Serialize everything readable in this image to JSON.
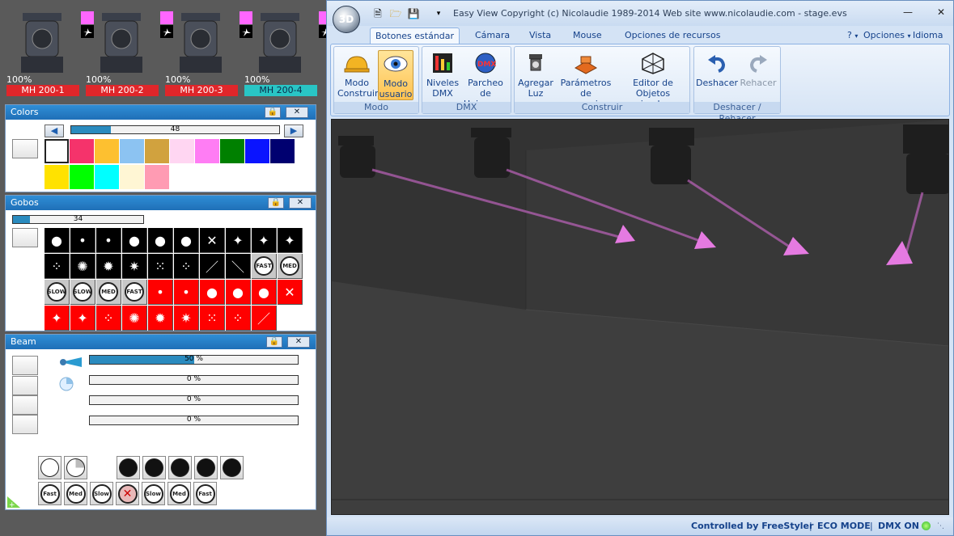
{
  "fixtures": [
    {
      "name": "MH 200-1",
      "percent": "100%",
      "selected": false
    },
    {
      "name": "MH 200-2",
      "percent": "100%",
      "selected": false
    },
    {
      "name": "MH 200-3",
      "percent": "100%",
      "selected": false
    },
    {
      "name": "MH 200-4",
      "percent": "100%",
      "selected": true
    }
  ],
  "colors_panel": {
    "title": "Colors",
    "value": "48",
    "value_fraction": 0.19,
    "swatches": [
      "#ffffff",
      "#f5336b",
      "#fdc030",
      "#8cc3f2",
      "#d1a23e",
      "#ffd6f2",
      "#ff7df4",
      "#008000",
      "#0a14ff",
      "#000070",
      "#ffe200",
      "#00ff00",
      "#00ffff",
      "#fff6d4",
      "#ff9bb3"
    ]
  },
  "gobos_panel": {
    "title": "Gobos",
    "value": "34",
    "value_fraction": 0.13
  },
  "beam_panel": {
    "title": "Beam",
    "bars": [
      {
        "label": "50 %",
        "fraction": 0.5
      },
      {
        "label": "0 %",
        "fraction": 0
      },
      {
        "label": "0 %",
        "fraction": 0
      },
      {
        "label": "0 %",
        "fraction": 0
      }
    ],
    "speed_row": [
      "Fast",
      "Med",
      "Slow",
      "",
      "Slow",
      "Med",
      "Fast"
    ]
  },
  "window": {
    "title": "Easy View   Copyright (c) Nicolaudie 1989-2014   Web site www.nicolaudie.com - stage.evs",
    "orb_label": "3D",
    "tabs": [
      "Botones estándar",
      "Cámara",
      "Vista",
      "Mouse",
      "Opciones de recursos"
    ],
    "right_menus": [
      "?",
      "Opciones",
      "Idioma"
    ],
    "groups": [
      {
        "label": "Modo",
        "buttons": [
          "Modo Construir",
          "Modo usuario"
        ]
      },
      {
        "label": "DMX",
        "buttons": [
          "Niveles DMX",
          "Parcheo de Universos"
        ]
      },
      {
        "label": "Construir",
        "buttons": [
          "Agregar Luz",
          "Parámetros de escenario...",
          "Editor de Objetos simples"
        ]
      },
      {
        "label": "Deshacer / Rehacer",
        "buttons": [
          "Deshacer",
          "Rehacer"
        ]
      }
    ]
  },
  "status": {
    "controlled": "Controlled by FreeStyler",
    "eco": "ECO MODE",
    "dmx": "DMX ON"
  }
}
